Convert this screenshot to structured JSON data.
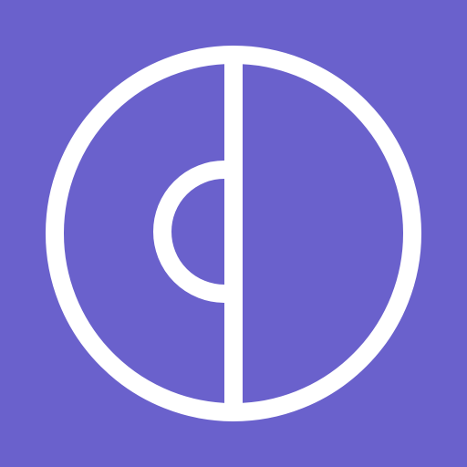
{
  "app_icon": {
    "icon_name": "split-circle-logo-icon",
    "colors": {
      "background": "#6a61cc",
      "foreground": "#ffffff"
    }
  }
}
